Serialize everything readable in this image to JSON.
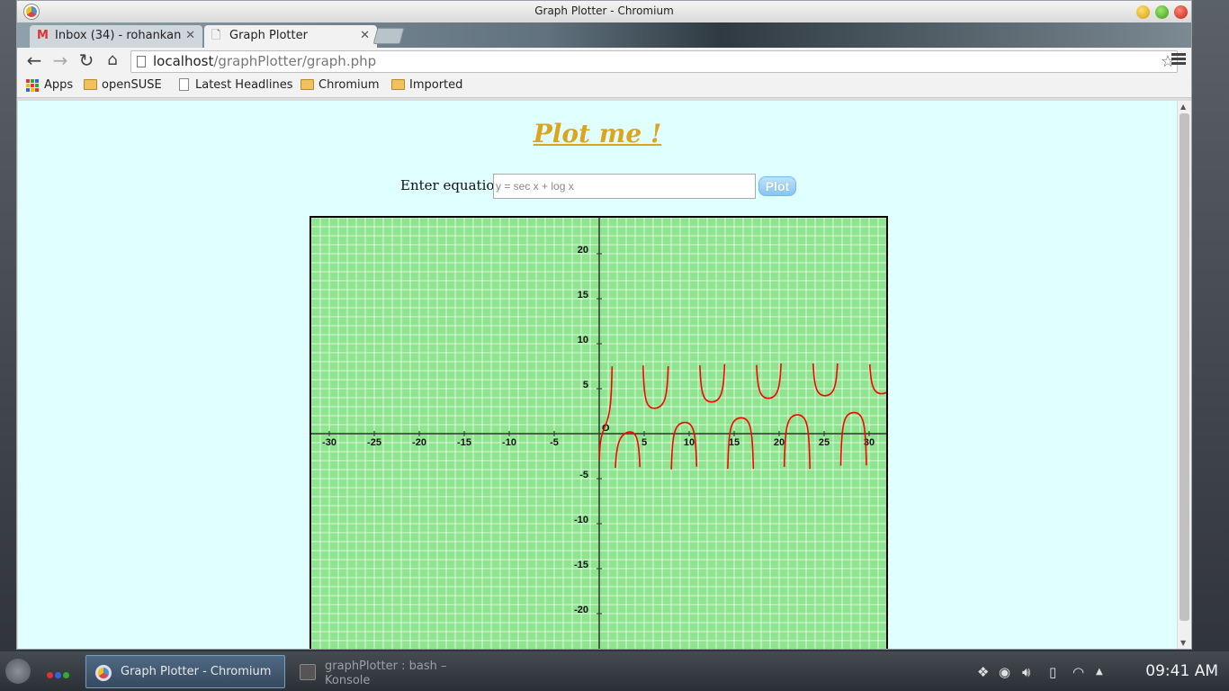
{
  "window": {
    "title": "Graph Plotter - Chromium"
  },
  "tabs": [
    {
      "label": "Inbox (34) - rohankan",
      "icon": "gmail-icon"
    },
    {
      "label": "Graph Plotter",
      "icon": "page-icon"
    }
  ],
  "toolbar": {
    "url_host": "localhost",
    "url_path": "/graphPlotter/graph.php"
  },
  "bookmarks": [
    {
      "label": "Apps",
      "icon": "apps-grid-icon"
    },
    {
      "label": "openSUSE",
      "icon": "folder-icon"
    },
    {
      "label": "Latest Headlines",
      "icon": "page-icon"
    },
    {
      "label": "Chromium",
      "icon": "folder-icon"
    },
    {
      "label": "Imported",
      "icon": "folder-icon"
    }
  ],
  "page": {
    "title": "Plot me !",
    "equation_label": "Enter equation:",
    "equation_placeholder": "y = sec x + log x",
    "plot_button": "Plot"
  },
  "chart_data": {
    "type": "line",
    "title": "",
    "xlabel": "",
    "ylabel": "",
    "origin_label": "O",
    "xlim": [
      -32,
      32
    ],
    "ylim": [
      -24,
      24
    ],
    "x_ticks": [
      -30,
      -25,
      -20,
      -15,
      -10,
      -5,
      5,
      10,
      15,
      20,
      25,
      30
    ],
    "y_ticks": [
      20,
      15,
      10,
      5,
      -5,
      -10,
      -15,
      -20
    ],
    "grid": true,
    "background_color": "#8fe58f",
    "grid_color": "#f4fff4",
    "curve_color": "#ff0000",
    "series": [
      {
        "function": "sec x + log x",
        "x_range": [
          0.02,
          31.9
        ]
      }
    ]
  },
  "taskbar": {
    "tasks": [
      {
        "label": "Graph Plotter - Chromium"
      },
      {
        "label": "graphPlotter : bash – Konsole"
      }
    ],
    "clock": "09:41 AM"
  }
}
